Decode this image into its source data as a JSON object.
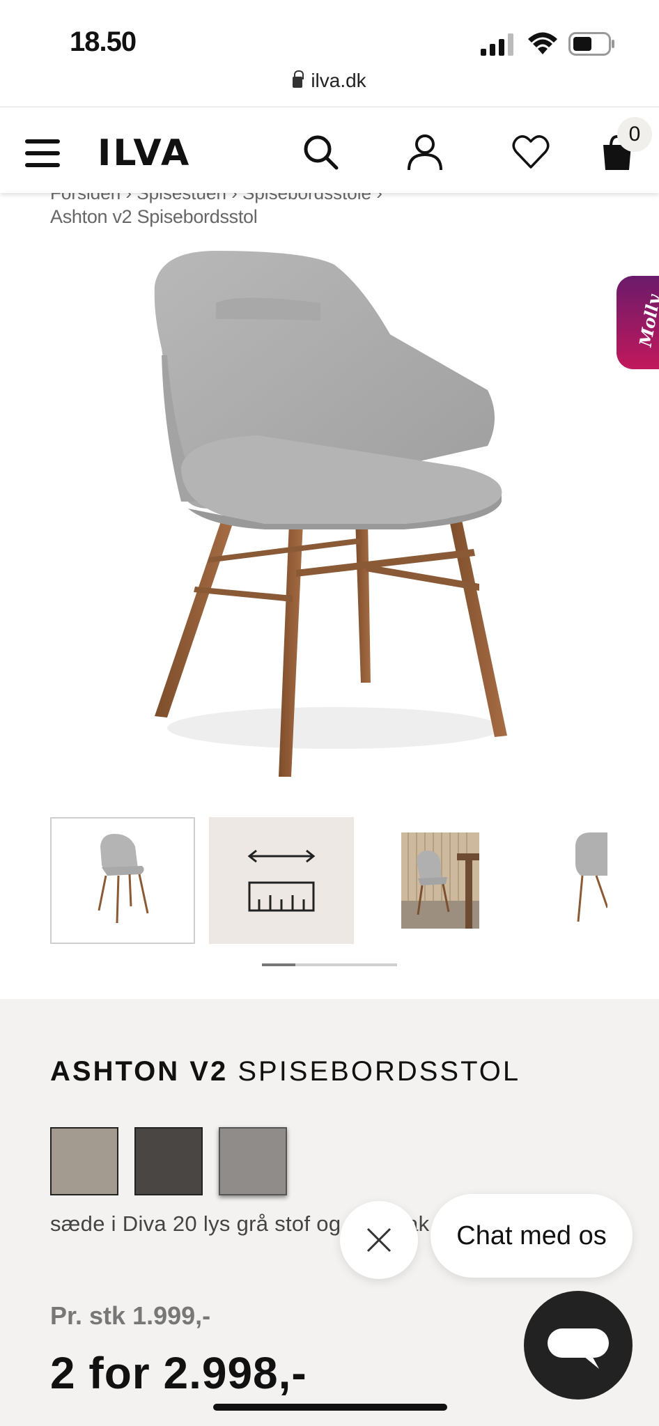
{
  "status_bar": {
    "time": "18.50",
    "url": "ilva.dk"
  },
  "header": {
    "logo": "ILVA",
    "cart_count": "0"
  },
  "breadcrumb": {
    "partial": "Forsiden  ›  Spisestuen  ›  Spisebordsstole  ›",
    "current": "Ashton v2 Spisebordsstol"
  },
  "molly_tab": {
    "label": "Molly"
  },
  "product": {
    "name_bold": "ASHTON V2",
    "name_rest": "SPISEBORDSSTOL",
    "variant_text": "sæde i Diva 20 lys grå stof og ben i lak",
    "price_unit": "Pr. stk 1.999,-",
    "price_offer": "2 for 2.998,-",
    "swatches": [
      {
        "name": "beige",
        "color": "#a49b90"
      },
      {
        "name": "dark-grey",
        "color": "#4a4643"
      },
      {
        "name": "light-grey",
        "color": "#8f8c89",
        "selected": true
      }
    ]
  },
  "chat": {
    "label": "Chat med os"
  },
  "colors": {
    "info_bg": "#f3f2f0",
    "molly_gradient_start": "#6a1b6b",
    "molly_gradient_end": "#c2185b"
  }
}
